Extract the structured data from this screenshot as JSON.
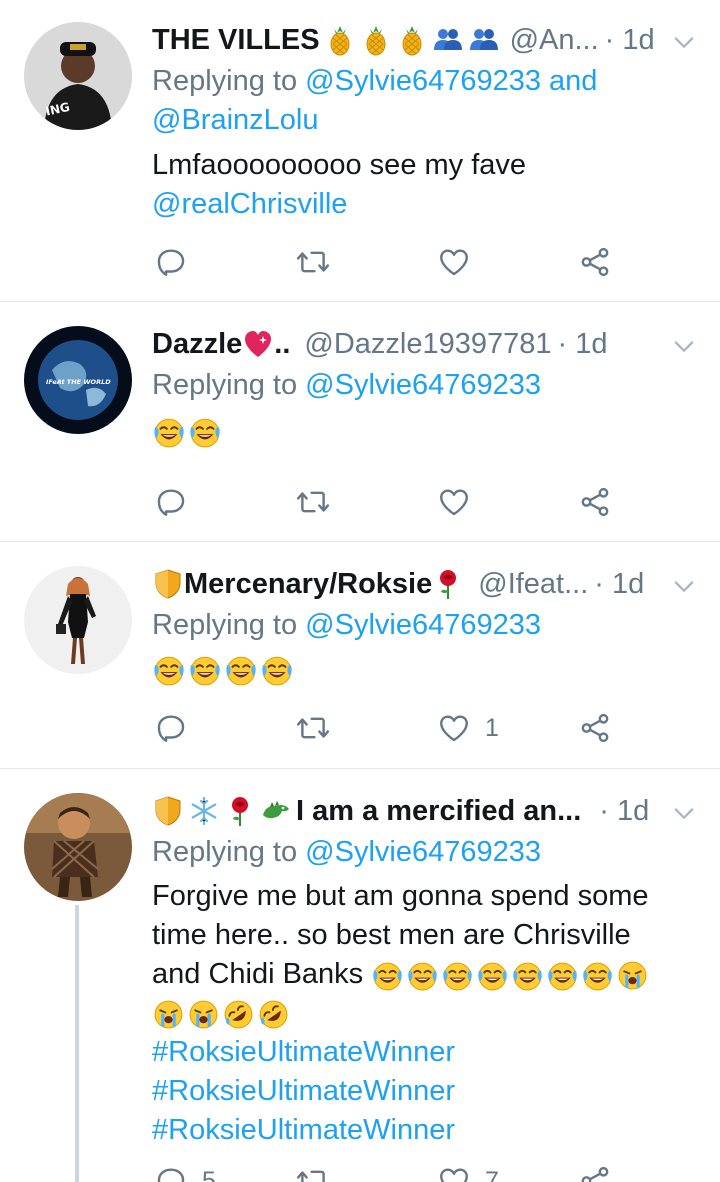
{
  "tweets": [
    {
      "name": "THE VILLES",
      "name_emoji": [
        "pineapple-emoji",
        "pineapple-emoji",
        "pineapple-emoji",
        "busts-emoji",
        "busts-emoji"
      ],
      "handle": "@An...",
      "time": "· 1d",
      "replying_prefix": "Replying to",
      "replying_to": "@Sylvie64769233 and",
      "replying_to_2": "@BrainzLolu",
      "text": "Lmfaooooooooo see my fave",
      "text_mention": "@realChrisville",
      "likes": ""
    },
    {
      "name": "Dazzle",
      "name_suffix": "..",
      "handle": "@Dazzle19397781",
      "time": "· 1d",
      "replying_prefix": "Replying to",
      "replying_to": "@Sylvie64769233",
      "emoji_body": [
        "joy-emoji",
        "joy-emoji"
      ],
      "likes": ""
    },
    {
      "name": "Mercenary/Roksie",
      "handle": "@Ifeat...",
      "time": "· 1d",
      "replying_prefix": "Replying to",
      "replying_to": "@Sylvie64769233",
      "emoji_body": [
        "joy-emoji",
        "joy-emoji",
        "joy-emoji",
        "joy-emoji"
      ],
      "likes": "1"
    },
    {
      "name": "I am a mercified an...",
      "handle": "",
      "time": "· 1d",
      "replying_prefix": "Replying to",
      "replying_to": "@Sylvie64769233",
      "text_line1": "Forgive me but am gonna spend some",
      "text_line2": "time here.. so best men are Chrisville",
      "text_line3": "and Chidi Banks",
      "hashtag1": "#RoksieUltimateWinner",
      "hashtag2": "#RoksieUltimateWinner",
      "hashtag3": "#RoksieUltimateWinner",
      "reply_count": "5",
      "like_count": "7"
    }
  ],
  "colors": {
    "accent": "#1da1f2",
    "secondary": "#657786",
    "divider": "#e1e8ed"
  }
}
